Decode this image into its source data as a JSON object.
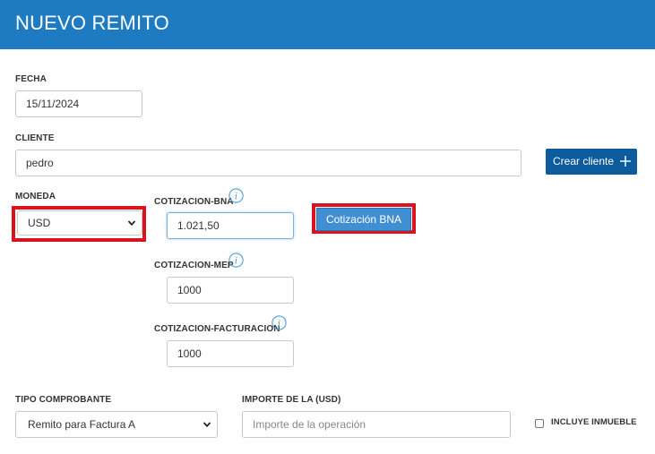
{
  "header": {
    "title": "NUEVO REMITO"
  },
  "fecha": {
    "label": "FECHA",
    "value": "15/11/2024"
  },
  "cliente": {
    "label": "CLIENTE",
    "value": "pedro",
    "create_button": "Crear cliente"
  },
  "moneda": {
    "label": "MONEDA",
    "selected": "USD"
  },
  "cotizacion_bna": {
    "label": "COTIZACION-BNA",
    "value": "1.021,50",
    "button": "Cotización BNA"
  },
  "cotizacion_mep": {
    "label": "COTIZACION-MEP",
    "value": "1000"
  },
  "cotizacion_facturacion": {
    "label": "COTIZACION-FACTURACION",
    "value": "1000"
  },
  "tipo_comprobante": {
    "label": "TIPO COMPROBANTE",
    "selected": "Remito para Factura A"
  },
  "importe": {
    "label": "IMPORTE DE LA (USD)",
    "placeholder": "Importe de la operación"
  },
  "incluye_inmueble": {
    "label": "INCLUYE INMUEBLE",
    "checked": false
  },
  "colors": {
    "header": "#1f7bc1",
    "primary_button": "#0c5b9c",
    "secondary_button": "#3f8fd2",
    "highlight": "#d9141e"
  },
  "icons": [
    "info-icon",
    "plus-icon",
    "chevron-down-icon"
  ]
}
